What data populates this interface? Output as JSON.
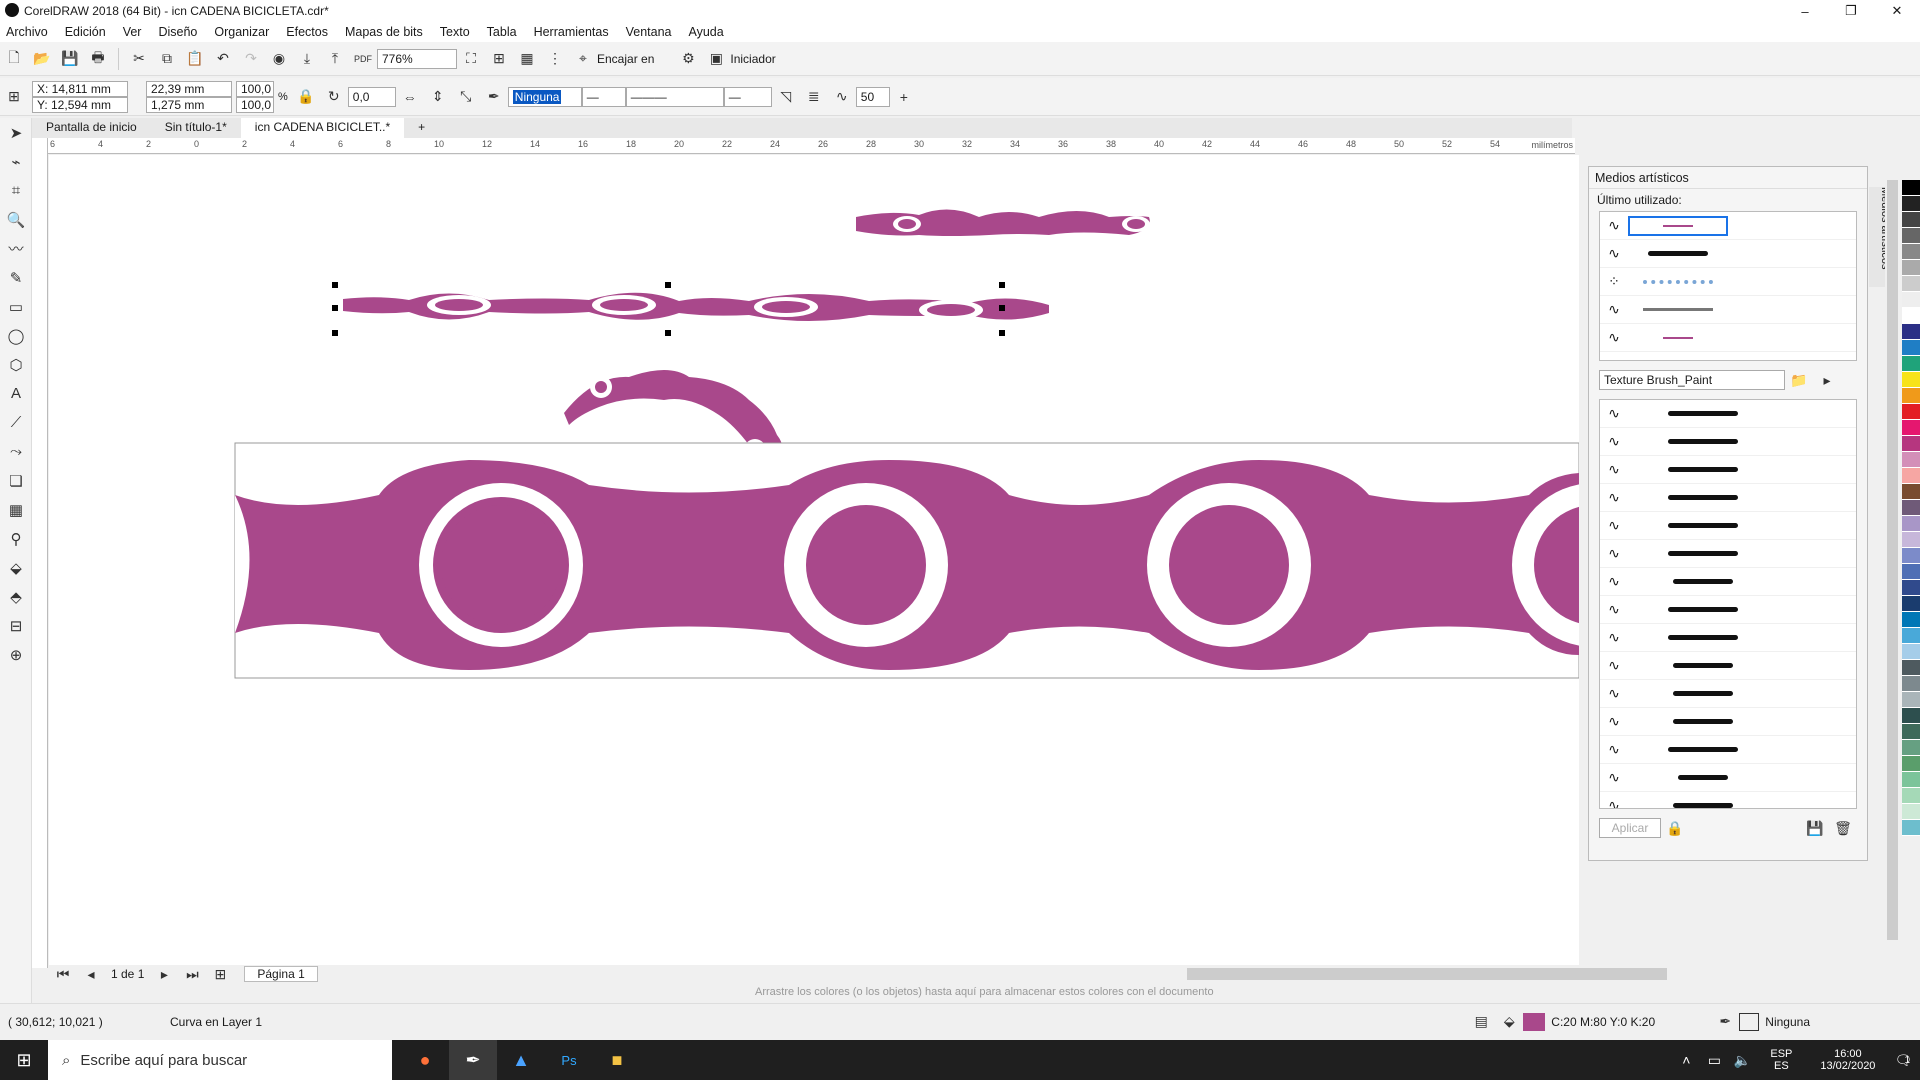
{
  "window": {
    "title": "CorelDRAW 2018 (64 Bit) - icn CADENA BICICLETA.cdr*"
  },
  "menu": [
    "Archivo",
    "Edición",
    "Ver",
    "Diseño",
    "Organizar",
    "Efectos",
    "Mapas de bits",
    "Texto",
    "Tabla",
    "Herramientas",
    "Ventana",
    "Ayuda"
  ],
  "toolbar": {
    "zoom": "776%",
    "snap_label": "Encajar en",
    "launcher_label": "Iniciador"
  },
  "props": {
    "x": "X: 14,811 mm",
    "y": "Y: 12,594 mm",
    "width": "22,39 mm",
    "height": "1,275 mm",
    "scale_w": "100,0",
    "scale_h": "100,0",
    "percent": "%",
    "angle": "0,0",
    "outline": "Ninguna",
    "smooth": "50"
  },
  "tabs": [
    "Pantalla de inicio",
    "Sin título-1*",
    "icn CADENA BICICLET..*"
  ],
  "ruler": {
    "unit": "milímetros",
    "ticks": [
      "6",
      "4",
      "2",
      "0",
      "2",
      "4",
      "6",
      "8",
      "10",
      "12",
      "14",
      "16",
      "18",
      "20",
      "22",
      "24",
      "26",
      "28",
      "30",
      "32",
      "34",
      "36",
      "38",
      "40",
      "42",
      "44",
      "46",
      "48",
      "50",
      "52",
      "54"
    ]
  },
  "docker": {
    "title": "Medios artísticos",
    "recent_label": "Último utilizado:",
    "category": "Texture Brush_Paint",
    "apply": "Aplicar",
    "side_tab": "Medios artísticos"
  },
  "pagebar": {
    "page_count": "1 de 1",
    "page_tab": "Página 1"
  },
  "colorstrip": {
    "hint": "Arrastre los colores (o los objetos) hasta aquí para almacenar estos colores con el documento"
  },
  "status": {
    "coords": "( 30,612; 10,021 )",
    "object": "Curva en Layer 1",
    "fill": "C:20 M:80 Y:0 K:20",
    "outline": "Ninguna"
  },
  "taskbar": {
    "search": "Escribe aquí para buscar",
    "lang1": "ESP",
    "lang2": "ES",
    "time": "16:00",
    "date": "13/02/2020",
    "notif": "1"
  },
  "colors": {
    "chain": "#a9488b",
    "palette": [
      "#000",
      "#222",
      "#444",
      "#666",
      "#888",
      "#aaa",
      "#ccc",
      "#eee",
      "#fff",
      "#2b2f86",
      "#1f7ec5",
      "#1fa37a",
      "#f7e31a",
      "#f09a1a",
      "#e31e24",
      "#e5176f",
      "#b6367f",
      "#d38fb8",
      "#f6a6a3",
      "#794c2f",
      "#6f5a78",
      "#a896c7",
      "#c7b7da",
      "#7c8bc9",
      "#4f6fb5",
      "#304a8c",
      "#1a3c6e",
      "#0077b6",
      "#49a9d9",
      "#a5cde9",
      "#4e5a5f",
      "#7d898e",
      "#aab5b9",
      "#2d4f4e",
      "#3e6a5a",
      "#66a082",
      "#5a9e6b",
      "#7cc49a",
      "#a5d9b7",
      "#cde9d6",
      "#6dbecd"
    ]
  }
}
